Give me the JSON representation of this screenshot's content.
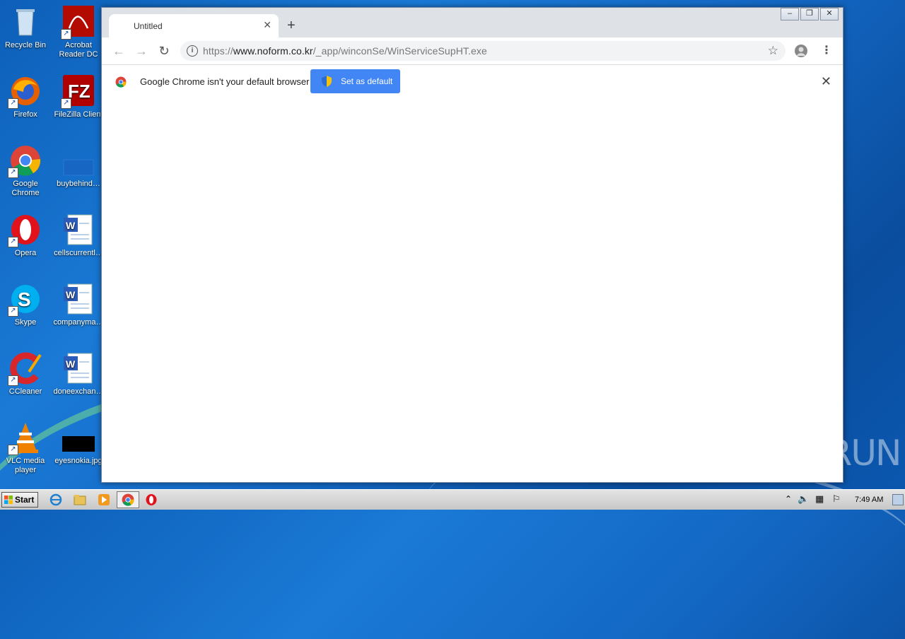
{
  "desktop": {
    "icons": [
      {
        "label": "Recycle Bin"
      },
      {
        "label": "Acrobat Reader DC"
      },
      {
        "label": "Firefox"
      },
      {
        "label": "FileZilla Client"
      },
      {
        "label": "Google Chrome"
      },
      {
        "label": "buybehind…"
      },
      {
        "label": "Opera"
      },
      {
        "label": "cellscurrentl…"
      },
      {
        "label": "Skype"
      },
      {
        "label": "companyma…"
      },
      {
        "label": "CCleaner"
      },
      {
        "label": "doneexchan…"
      },
      {
        "label": "VLC media player"
      },
      {
        "label": "eyesnokia.jpg"
      }
    ]
  },
  "browser": {
    "tab_title": "Untitled",
    "url_scheme": "https://",
    "url_host": "www.noform.co.kr",
    "url_path": "/_app/winconSe/WinServiceSupHT.exe",
    "infobar_text": "Google Chrome isn't your default browser",
    "set_default_label": "Set as default"
  },
  "watermark": "ANY▷RUN",
  "taskbar": {
    "start_label": "Start",
    "clock": "7:49 AM"
  },
  "colors": {
    "accent": "#4285f4",
    "desktop": "#1368c4"
  }
}
